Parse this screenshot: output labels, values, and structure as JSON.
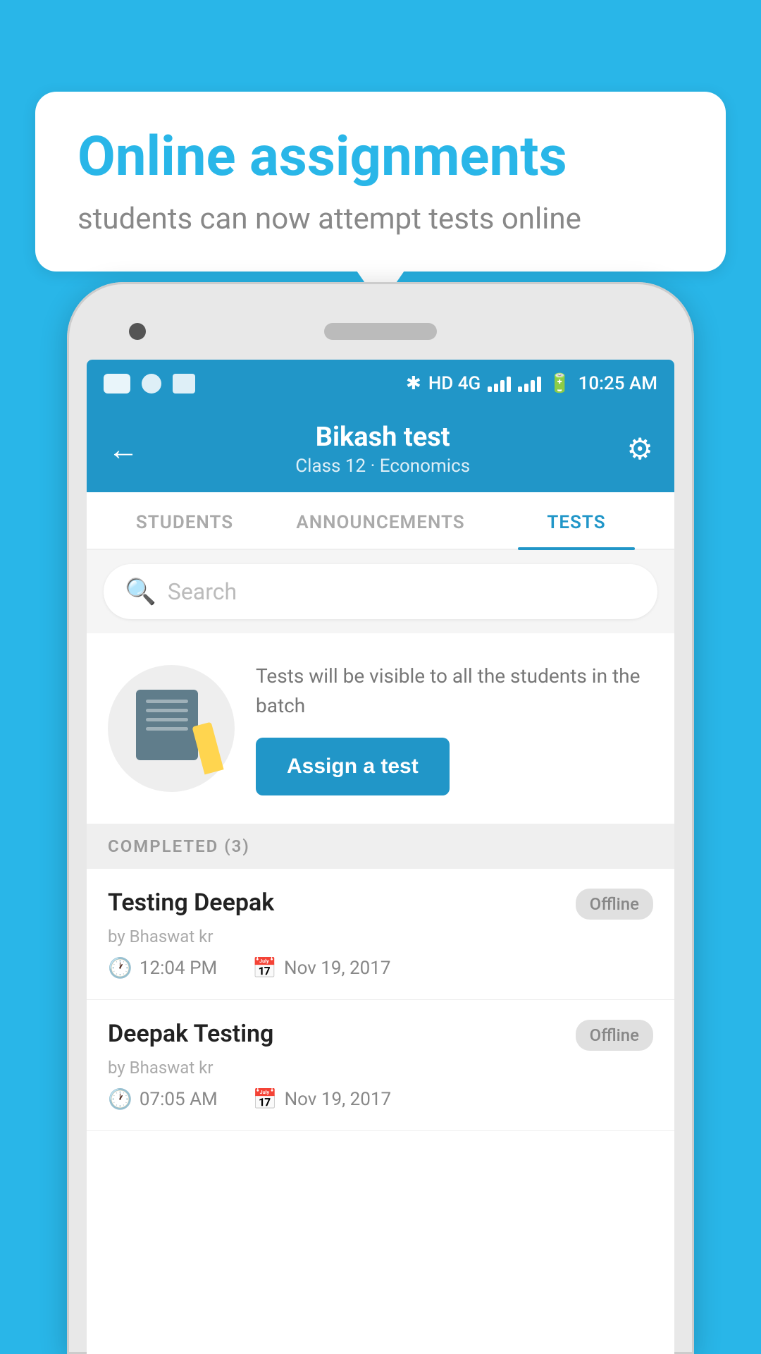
{
  "background_color": "#29b6e8",
  "bubble": {
    "title": "Online assignments",
    "subtitle": "students can now attempt tests online"
  },
  "status_bar": {
    "time": "10:25 AM",
    "network": "HD 4G"
  },
  "header": {
    "title": "Bikash test",
    "subtitle": "Class 12 · Economics",
    "back_label": "←",
    "settings_label": "⚙"
  },
  "tabs": [
    {
      "label": "STUDENTS",
      "active": false
    },
    {
      "label": "ANNOUNCEMENTS",
      "active": false
    },
    {
      "label": "TESTS",
      "active": true
    }
  ],
  "search": {
    "placeholder": "Search"
  },
  "assign_section": {
    "info_text": "Tests will be visible to all the students in the batch",
    "button_label": "Assign a test"
  },
  "completed_section": {
    "header": "COMPLETED (3)",
    "items": [
      {
        "name": "Testing Deepak",
        "by": "by Bhaswat kr",
        "time": "12:04 PM",
        "date": "Nov 19, 2017",
        "status": "Offline"
      },
      {
        "name": "Deepak Testing",
        "by": "by Bhaswat kr",
        "time": "07:05 AM",
        "date": "Nov 19, 2017",
        "status": "Offline"
      }
    ]
  }
}
